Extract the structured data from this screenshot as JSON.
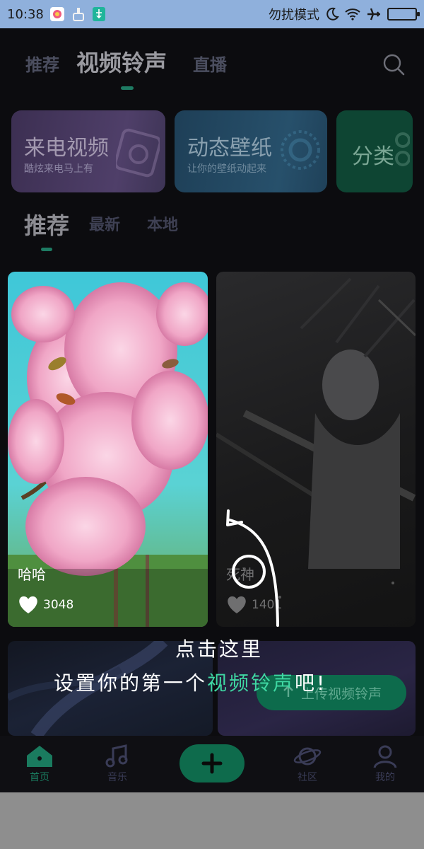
{
  "status_bar": {
    "time": "10:38",
    "dnd_label": "勿扰模式",
    "battery_level": 0.95
  },
  "top_nav": {
    "tabs": [
      {
        "label": "推荐",
        "active": false
      },
      {
        "label": "视频铃声",
        "active": true
      },
      {
        "label": "直播",
        "active": false
      }
    ],
    "search_icon": "search-icon"
  },
  "category_cards": [
    {
      "title": "来电视频",
      "subtitle": "酷炫来电马上有",
      "icon": "camera-icon"
    },
    {
      "title": "动态壁纸",
      "subtitle": "让你的壁纸动起来",
      "icon": "lens-icon"
    },
    {
      "title": "分类",
      "subtitle": "",
      "icon": "grid-icon"
    }
  ],
  "sub_tabs": [
    {
      "label": "推荐",
      "active": true
    },
    {
      "label": "最新",
      "active": false
    },
    {
      "label": "本地",
      "active": false
    }
  ],
  "videos": [
    {
      "name": "哈哈",
      "likes": "3048"
    },
    {
      "name": "死神",
      "likes": "1401"
    }
  ],
  "upload_button": {
    "label": "上传视频铃声"
  },
  "bottom_nav": [
    {
      "label": "首页",
      "icon": "home-icon",
      "active": true
    },
    {
      "label": "音乐",
      "icon": "music-note-icon",
      "active": false
    },
    {
      "label": "社区",
      "icon": "planet-icon",
      "active": false
    },
    {
      "label": "我的",
      "icon": "user-icon",
      "active": false
    }
  ],
  "fab": {
    "icon": "plus-icon"
  },
  "guide": {
    "line1": "点击这里",
    "line2_prefix": "设置你的第一个",
    "line2_highlight": "视频铃声",
    "line2_suffix": "吧!"
  },
  "colors": {
    "accent": "#1e7b63",
    "highlight": "#3fd8a3",
    "status_bar": "#8fb0dc"
  }
}
